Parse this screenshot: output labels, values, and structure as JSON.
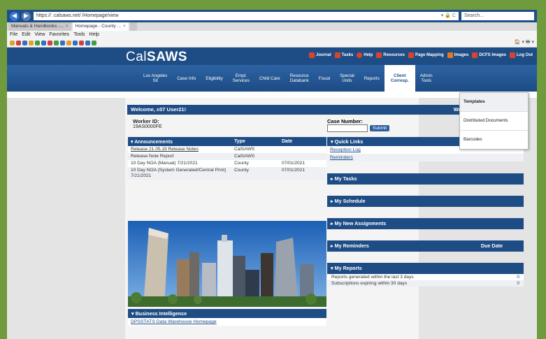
{
  "browser": {
    "url": "https://          .calsaws.net/                     /Homepage/view",
    "url_controls": "▾ 🔒 C",
    "search_placeholder": "Search...",
    "tabs": [
      {
        "label": "Manuals & Handbooks -..."
      },
      {
        "label": "Homepage - County ..."
      }
    ],
    "menu": [
      "File",
      "Edit",
      "View",
      "Favorites",
      "Tools",
      "Help"
    ],
    "favbar_right": "🏠 ▾ 🖶 ▾"
  },
  "app": {
    "logo_part1": "Cal",
    "logo_part2": "SAWS",
    "top_links": [
      {
        "label": "Journal",
        "color": "#d6452b"
      },
      {
        "label": "Tasks",
        "color": "#d6452b"
      },
      {
        "label": "Help",
        "color": "#d6452b"
      },
      {
        "label": "Resources",
        "color": "#d6452b"
      },
      {
        "label": "Page Mapping",
        "color": "#d6452b"
      },
      {
        "label": "Images",
        "color": "#e07a1c"
      },
      {
        "label": "DCFS Images",
        "color": "#d6452b"
      },
      {
        "label": "Log Out",
        "color": "#d6452b"
      }
    ],
    "nav": [
      {
        "label": "Los Angeles\nSit"
      },
      {
        "label": "Case Info"
      },
      {
        "label": "Eligibility"
      },
      {
        "label": "Empl.\nServices"
      },
      {
        "label": "Child Care"
      },
      {
        "label": "Resource\nDatabank"
      },
      {
        "label": "Fiscal"
      },
      {
        "label": "Special\nUnits"
      },
      {
        "label": "Reports"
      },
      {
        "label": "Client\nCorresp."
      },
      {
        "label": "Admin\nTools"
      }
    ]
  },
  "welcome": {
    "text": "Welcome, c07 User21!",
    "right_text": "Wedn"
  },
  "worker": {
    "label": "Worker ID:",
    "value": "19AS0000FE"
  },
  "case": {
    "label": "Case Number:",
    "submit": "Submit"
  },
  "announcements": {
    "headers": [
      "Announcements",
      "Type",
      "Date"
    ],
    "rows": [
      {
        "title": "Release 21.05.19 Release Notes",
        "type": "CalSAWS",
        "date": "",
        "link": true
      },
      {
        "title": "Release Note Report",
        "type": "CalSAWS",
        "date": "",
        "link": true
      },
      {
        "title": "10 Day NOA (Manual) 7/21/2021",
        "type": "County",
        "date": "07/01/2021",
        "link": false
      },
      {
        "title": "10 Day NOA (System Generated/Central Print) 7/21/2021",
        "type": "County",
        "date": "07/01/2021",
        "link": false
      }
    ]
  },
  "business_intelligence": {
    "header": "Business Intelligence",
    "link": "DPSSTATS Data Warehouse Homepage"
  },
  "quick_links": {
    "header": "Quick Links",
    "items": [
      "Reception Log",
      "Reminders"
    ]
  },
  "panels": {
    "tasks": "My Tasks",
    "schedule": "My Schedule",
    "assignments": "My New Assignments",
    "reminders": "My Reminders",
    "reminders_due": "Due Date",
    "reports": "My Reports"
  },
  "reports": {
    "rows": [
      {
        "label": "Reports generated within the last 3 days",
        "count": "0"
      },
      {
        "label": "Subscriptions expiring within 30 days",
        "count": "0"
      }
    ]
  },
  "dropdown": {
    "items": [
      "Templates",
      "Distributed Documents",
      "Barcodes"
    ]
  }
}
